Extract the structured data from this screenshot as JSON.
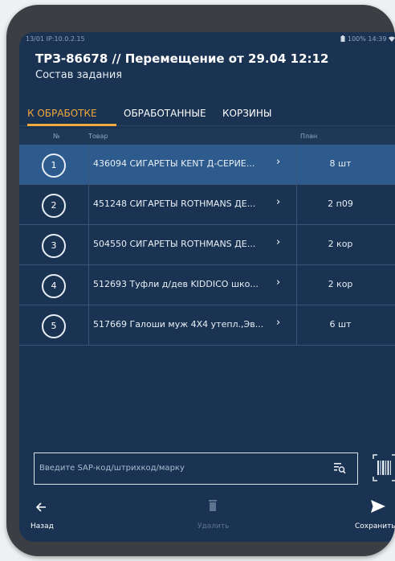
{
  "status_bar": {
    "left": "13/01 IP:10.0.2.15",
    "right": "100% 14:39"
  },
  "header": {
    "title": "ТРЗ-86678 // Перемещение  от 29.04 12:12",
    "subtitle": "Состав задания"
  },
  "tabs": [
    {
      "label": "К ОБРАБОТКЕ",
      "active": true
    },
    {
      "label": "ОБРАБОТАННЫЕ",
      "active": false
    },
    {
      "label": "КОРЗИНЫ",
      "active": false
    }
  ],
  "table": {
    "columns": {
      "num": "№",
      "item": "Товар",
      "plan": "План"
    },
    "rows": [
      {
        "num": "1",
        "name": "436094 СИГАРЕТЫ KENT Д-СЕРИЕ...",
        "plan": "8 шт",
        "selected": true
      },
      {
        "num": "2",
        "name": "451248 СИГАРЕТЫ ROTHMANS ДЕ...",
        "plan": "2 п09",
        "selected": false
      },
      {
        "num": "3",
        "name": "504550 СИГАРЕТЫ ROTHMANS ДЕ...",
        "plan": "2 кор",
        "selected": false
      },
      {
        "num": "4",
        "name": "512693 Туфли д/дев KIDDICO шко...",
        "plan": "2 кор",
        "selected": false
      },
      {
        "num": "5",
        "name": "517669 Галоши муж 4X4 утепл.,Эв...",
        "plan": "6 шт",
        "selected": false
      }
    ]
  },
  "search": {
    "placeholder": "Введите SAP-код/штрихкод/марку",
    "value": ""
  },
  "bottom_nav": {
    "back_label": "Назад",
    "delete_label": "Удалить",
    "save_label": "Сохранить"
  },
  "colors": {
    "background": "#1b3352",
    "selected_row": "#2d5b8e",
    "accent": "#f2a93b"
  },
  "icons": {
    "back": "arrow-left-icon",
    "delete": "trash-icon",
    "save": "send-arrow-icon",
    "barcode": "barcode-scan-icon",
    "search": "list-search-icon",
    "row_open": "chevron-right-icon"
  }
}
